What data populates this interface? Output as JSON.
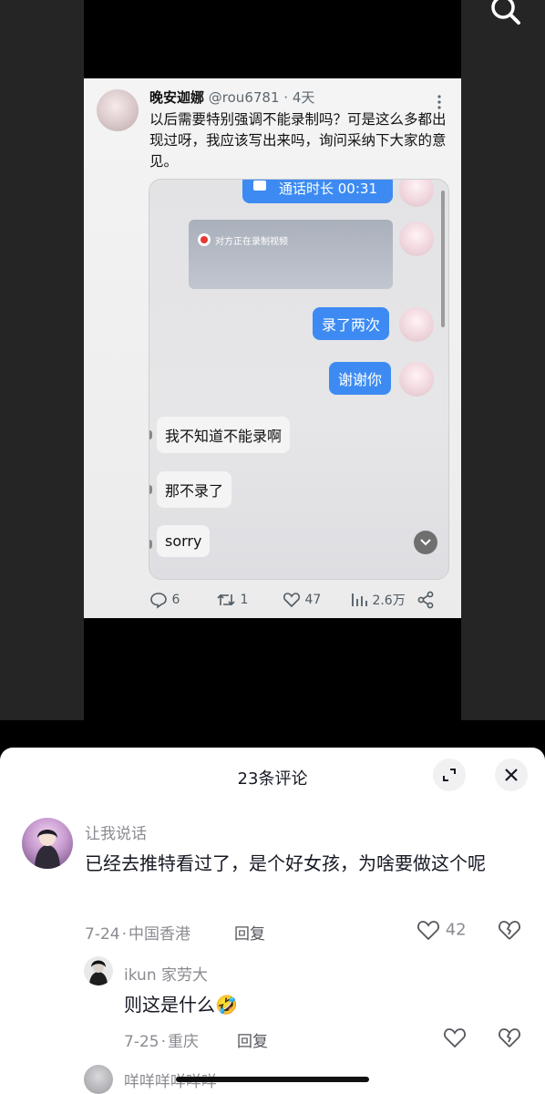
{
  "video": {
    "search_icon": "search-icon",
    "tweet": {
      "author_name": "晚安迦娜",
      "author_handle": "@rou6781",
      "separator": "·",
      "time": "4天",
      "text": "以后需要特别强调不能录制吗？可是这么多都出现过呀，我应该写出来吗，询问采纳下大家的意见。",
      "screenshot": {
        "call_label": "通话时长 00:31",
        "recording_notice": "对方正在录制视频",
        "messages_right": [
          "录了两次",
          "谢谢你"
        ],
        "messages_left": [
          "我不知道不能录啊",
          "那不录了",
          "sorry"
        ]
      },
      "stats": {
        "replies": "6",
        "retweets": "1",
        "likes": "47",
        "views": "2.6万"
      }
    }
  },
  "comments": {
    "title": "23条评论",
    "items": [
      {
        "user": "让我说话",
        "text": "已经去推特看过了，是个好女孩，为啥要做这个呢",
        "date": "7-24",
        "location": "中国香港",
        "reply_label": "回复",
        "likes": "42"
      },
      {
        "user": "ikun 家劳大",
        "text": "则这是什么",
        "emoji": "🤣",
        "date": "7-25",
        "location": "重庆",
        "reply_label": "回复",
        "likes": ""
      },
      {
        "user": "咩咩咩咩咩咩"
      }
    ]
  },
  "colors": {
    "accent_blue": "#3d8bf2",
    "sheet_bg": "#ffffff",
    "muted_text": "#8a8b91"
  }
}
